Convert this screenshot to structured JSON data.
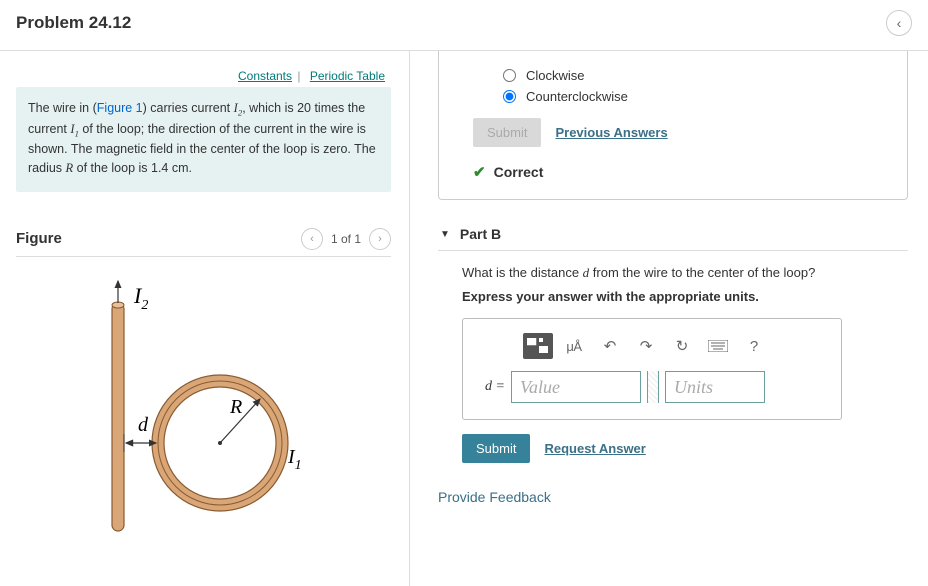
{
  "header": {
    "title": "Problem 24.12"
  },
  "links": {
    "constants": "Constants",
    "periodic": "Periodic Table"
  },
  "problem": {
    "pre": "The wire in (",
    "figlink": "Figure 1",
    "post1": ") carries current ",
    "i2": "I",
    "i2sub": "2",
    "post2": ", which is 20 times the current ",
    "i1": "I",
    "i1sub": "1",
    "post3": " of the loop; the direction of the current in the wire is shown. The magnetic field in the center of the loop is zero. The radius ",
    "r": "R",
    "post4": " of the loop is 1.4 ",
    "unit": "cm",
    "post5": "."
  },
  "figure": {
    "heading": "Figure",
    "pager": "1 of 1",
    "i2label": "I",
    "i2sub": "2",
    "dlabel": "d",
    "rlabel": "R",
    "i1label": "I",
    "i1sub": "1"
  },
  "partA": {
    "opt1": "Clockwise",
    "opt2": "Counterclockwise",
    "submit": "Submit",
    "prev": "Previous Answers",
    "correct": "Correct"
  },
  "partB": {
    "title": "Part B",
    "question_pre": "What is the distance ",
    "dvar": "d",
    "question_post": " from the wire to the center of the loop?",
    "instruct": "Express your answer with the appropriate units.",
    "units_tool": "μÅ",
    "help": "?",
    "eq_label_pre": "d",
    "eq_label_post": " =",
    "value_ph": "Value",
    "units_ph": "Units",
    "submit": "Submit",
    "request": "Request Answer"
  },
  "feedback": "Provide Feedback"
}
